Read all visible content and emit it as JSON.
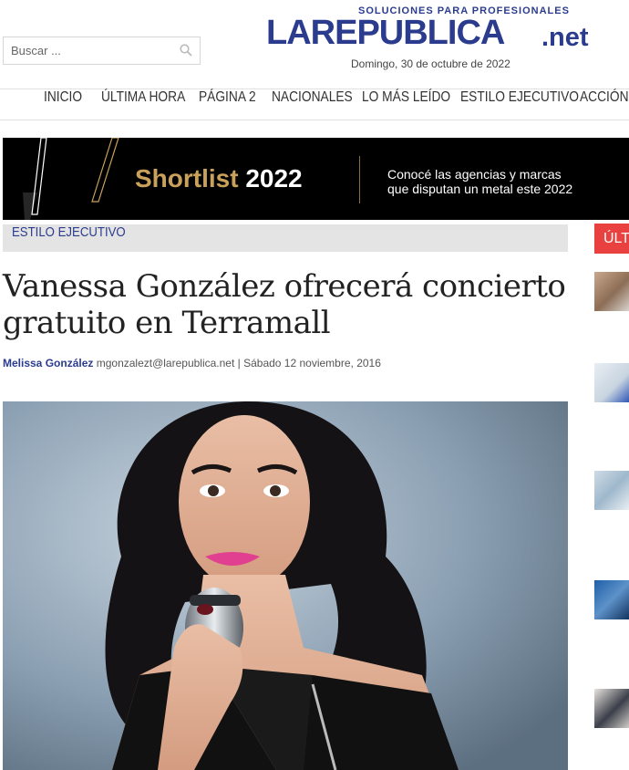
{
  "search": {
    "placeholder": "Buscar ..."
  },
  "logo": {
    "tagline": "SOLUCIONES PARA PROFESIONALES",
    "name": "LAREPUBLICA",
    "tld": ".net"
  },
  "header": {
    "date": "Domingo, 30 de octubre de 2022"
  },
  "nav": {
    "items": [
      "INICIO",
      "ÚLTIMA HORA",
      "PÁGINA 2",
      "NACIONALES",
      "LO MÁS LEÍDO",
      "ESTILO EJECUTIVO",
      "ACCIÓN"
    ]
  },
  "ad": {
    "title": "Shortlist",
    "year": "2022",
    "line1": "Conocé las agencias y marcas",
    "line2": "que disputan un metal este 2022"
  },
  "article": {
    "category": "ESTILO EJECUTIVO",
    "title": "Vanessa González ofrecerá concierto gratuito en Terramall",
    "author": "Melissa González",
    "meta": "mgonzalezt@larepublica.net | Sábado 12 noviembre, 2016"
  },
  "sidebar": {
    "tab_label": "ÚLTIMA HORA"
  },
  "colors": {
    "brand": "#2b3c8e",
    "accent_red": "#e8413f",
    "ad_gold": "#c9a15a"
  }
}
